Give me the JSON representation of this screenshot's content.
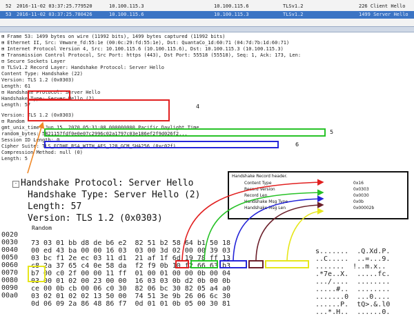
{
  "packet_list": {
    "rows": [
      {
        "no": "52",
        "time": "2016-11-02 03:37:25.779520",
        "src": "10.100.115.3",
        "dst": "10.100.115.6",
        "proto": "TLSv1.2",
        "info": "226 Client Hello"
      },
      {
        "no": "53",
        "time": "2016-11-02 03:37:25.780426",
        "src": "10.100.115.6",
        "dst": "10.100.115.3",
        "proto": "TLSv1.2",
        "info": "1499 Server Hello"
      }
    ]
  },
  "detail": {
    "rows": [
      "⊞ Frame 53: 1499 bytes on wire (11992 bits), 1499 bytes captured (11992 bits)",
      "⊞ Ethernet II, Src: Vmware_fd:55:1e (00:0c:29:fd:55:1e), Dst: QuantaCo_1d:60:71 (04:7d:7b:1d:60:71)",
      "⊞ Internet Protocol Version 4, Src: 10.100.115.6 (10.100.115.6), Dst: 10.100.115.3 (10.100.115.3)",
      "⊞ Transmission Control Protocol, Src Port: https (443), Dst Port: 55518 (55518), Seq: 1, Ack: 173, Len:",
      "⊟ Secure Sockets Layer",
      "  ⊟ TLSv1.2 Record Layer: Handshake Protocol: Server Hello",
      "      Content Type: Handshake (22)",
      "      Version: TLS 1.2 (0x0303)",
      "      Length: 61",
      "    ⊟ Handshake Protocol: Server Hello",
      "        Handshake Type: Server Hello (2)",
      "        Length: 57",
      "        Version: TLS 1.2 (0x0303)",
      "      ⊟ Random",
      "          gmt_unix_time: Jun 15, 2070 05:31:08.000000000 Pacific Daylight Time",
      "          random_bytes: 5821157fdf0e0e07c2996c02a1797c03e186ef2f9d026f2...",
      "        Session ID Length: 0",
      "        Cipher Suite: TLS_ECDHE_RSA_WITH_AES_128_GCM_SHA256 (0xc02f)",
      "        Compression Method: null (0)",
      "    Length: 5"
    ]
  },
  "overlay": {
    "line1": "Handshake Protocol: Server Hello",
    "line2": "Handshake Type: Server Hello (2)",
    "line3": "Length: 57",
    "line4": "Version: TLS 1.2 (0x0303)",
    "line5": "Random"
  },
  "notes": {
    "n4": "4",
    "n5": "5",
    "n6": "6"
  },
  "legend": {
    "title": "Handshake Record header.",
    "rows": [
      {
        "label": "Content Type",
        "value": "0x16"
      },
      {
        "label": "Record Version",
        "value": "0x0303"
      },
      {
        "label": "Record Len",
        "value": "0x0030"
      },
      {
        "label": "Handshake Msg Type",
        "value": "0x0b"
      },
      {
        "label": "Handshake Msg Len",
        "value": "0x00002b"
      }
    ]
  },
  "hex": {
    "rows": [
      {
        "off": "0020",
        "bytes": "73 03 01 bb d8 de b6 e2  82 51 b2 58 64 b1 50 18",
        "ascii": "s.......  .Q.Xd.P."
      },
      {
        "off": "0030",
        "bytes": "00 ed 43 ba 00 00 16 03  03 00 3d 02 00 00 39 03",
        "ascii": "..C.....  ..=...9."
      },
      {
        "off": "0040",
        "bytes": "03 bc f1 2e ec 03 11 d1  21 af 1f 6d 19 78 ff 13",
        "ascii": ".......  !..m.x.."
      },
      {
        "off": "0050",
        "bytes": "c8 2a 37 65 c4 0e 58 da  f2 f9 0b 10 f2 66 63 b3",
        "ascii": ".*7e..X.  .....fc."
      },
      {
        "off": "0060",
        "bytes": "b7 00 c0 2f 00 00 11 ff  01 00 01 00 00 0b 00 04",
        "ascii": ".../....  ........"
      },
      {
        "off": "0070",
        "bytes": "03 00 01 02 00 23 00 00  16 03 03 0b d2 0b 00 0b",
        "ascii": ".....#..  ........"
      },
      {
        "off": "0080",
        "bytes": "ce 00 0b cb 00 06 c0 30  82 06 bc 30 82 05 a4 a0",
        "ascii": ".......0  ...0...."
      },
      {
        "off": "0090",
        "bytes": "03 02 01 02 02 13 50 00  74 51 3e 9b 26 06 6c 30",
        "ascii": "......P.  tQ>.&.l0"
      },
      {
        "off": "00a0",
        "bytes": "0d 06 09 2a 86 48 86 f7  0d 01 01 0b 05 00 30 81",
        "ascii": "...*.H..  ......0."
      }
    ]
  },
  "colors": {
    "red": "#e11f1f",
    "green": "#27c227",
    "blue": "#2424d8",
    "yellow": "#e6e61a",
    "dark_red": "#6b1f2a",
    "orange": "#f08a2a",
    "selection": "#3b74c4"
  }
}
